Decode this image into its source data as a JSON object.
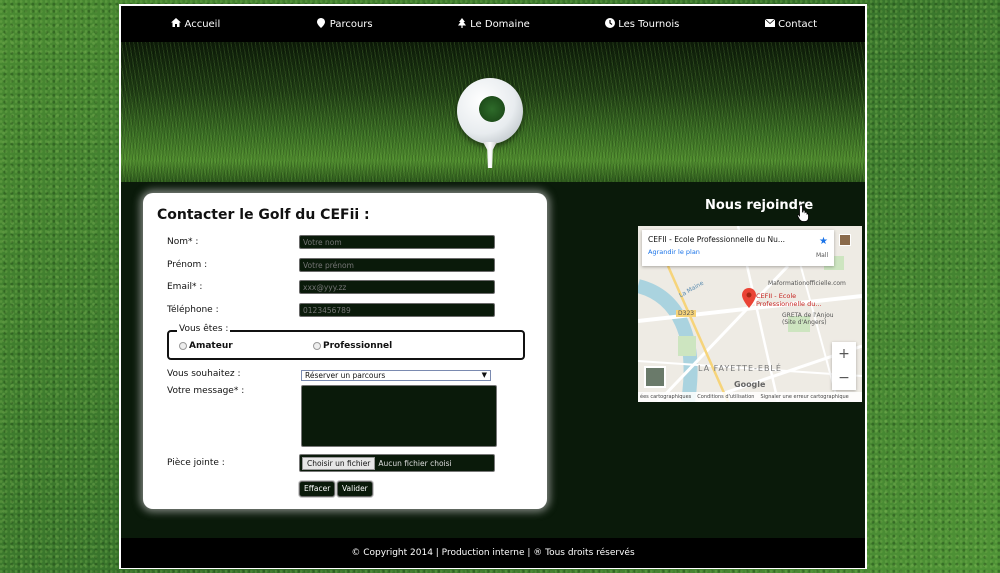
{
  "nav": {
    "items": [
      {
        "label": "Accueil",
        "icon": "home-icon"
      },
      {
        "label": "Parcours",
        "icon": "map-marker-icon"
      },
      {
        "label": "Le Domaine",
        "icon": "tree-icon"
      },
      {
        "label": "Les Tournois",
        "icon": "clock-icon"
      },
      {
        "label": "Contact",
        "icon": "envelope-icon"
      }
    ]
  },
  "form": {
    "title": "Contacter le Golf du CEFii :",
    "nom": {
      "label": "Nom* :",
      "placeholder": "Votre nom"
    },
    "prenom": {
      "label": "Prénom :",
      "placeholder": "Votre prénom"
    },
    "email": {
      "label": "Email* :",
      "placeholder": "xxx@yyy.zz"
    },
    "telephone": {
      "label": "Téléphone :",
      "placeholder": "0123456789"
    },
    "status": {
      "legend": "Vous êtes :",
      "options": [
        "Amateur",
        "Professionnel"
      ]
    },
    "wish": {
      "label": "Vous souhaitez :",
      "selected": "Réserver un parcours"
    },
    "message": {
      "label": "Votre message* :"
    },
    "attachment": {
      "label": "Pièce jointe :",
      "button": "Choisir un fichier",
      "status": "Aucun fichier choisi"
    },
    "buttons": {
      "reset": "Effacer",
      "submit": "Valider"
    }
  },
  "map_section": {
    "title": "Nous rejoindre",
    "card_title": "CEFII - Ecole Professionnelle du Nu...",
    "card_link": "Agrandir le plan",
    "pin_label": "CEFII - Ecole Professionnelle du...",
    "labels": [
      "Mall",
      "Maformationofficielle.com",
      "GRETA de l'Anjou (Site d'Angers)",
      "LA FAYETTE-EBLÉ",
      "La Maine",
      "D323"
    ],
    "google": "Google",
    "footer": [
      "ées cartographiques",
      "Conditions d'utilisation",
      "Signaler une erreur cartographique"
    ]
  },
  "footer": {
    "text": "© Copyright 2014 | Production interne | ® Tous droits réservés"
  }
}
